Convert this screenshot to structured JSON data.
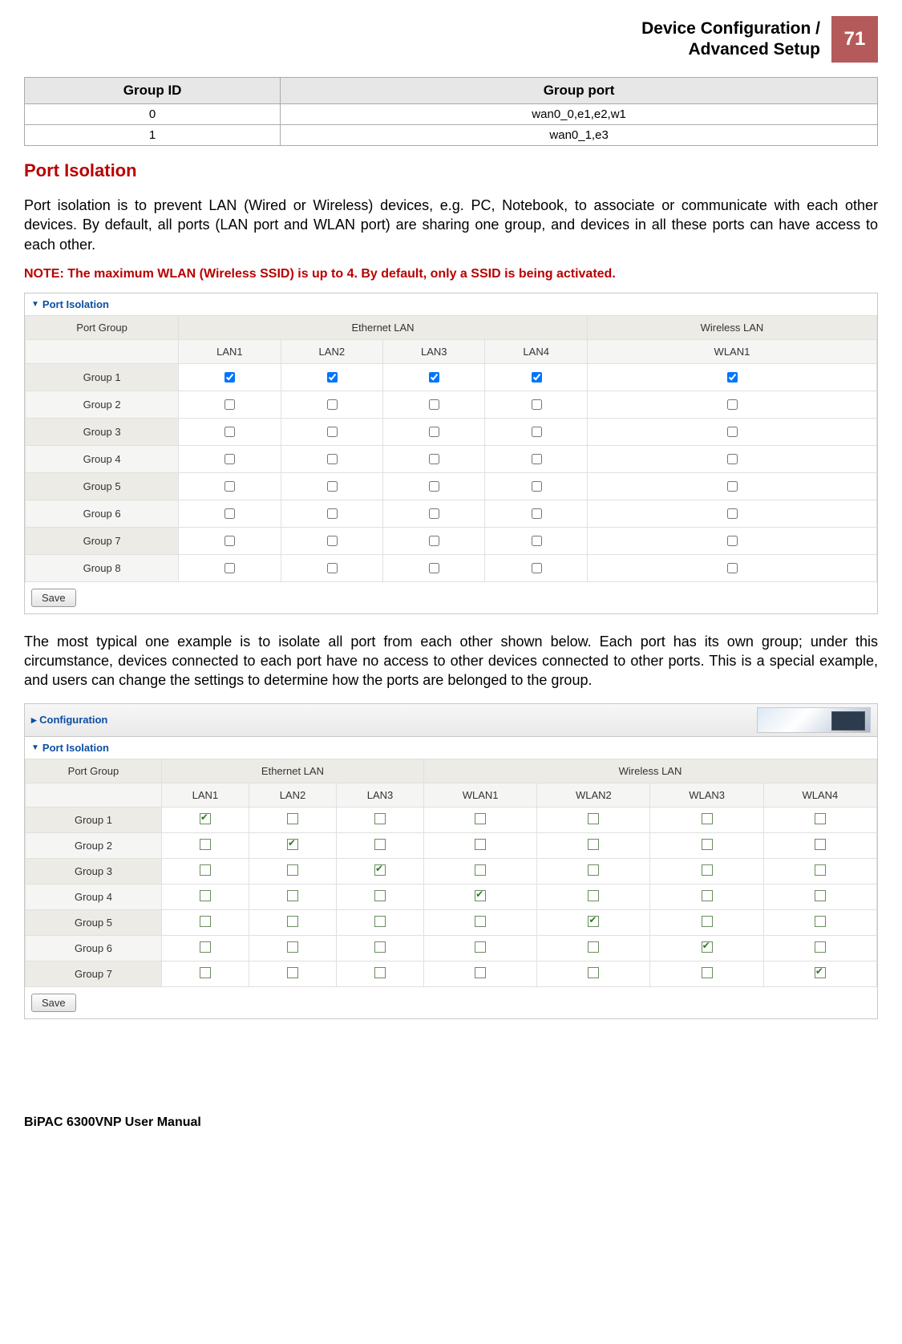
{
  "header": {
    "title_line1": "Device Configuration /",
    "title_line2": "Advanced Setup",
    "page_number": "71"
  },
  "group_table": {
    "headers": [
      "Group ID",
      "Group port"
    ],
    "rows": [
      [
        "0",
        "wan0_0,e1,e2,w1"
      ],
      [
        "1",
        "wan0_1,e3"
      ]
    ]
  },
  "section": {
    "title": "Port Isolation",
    "para1": "Port isolation is to prevent LAN (Wired or Wireless) devices, e.g. PC, Notebook, to associate or communicate with each other devices. By default, all ports (LAN port and WLAN port) are sharing one group, and devices in all these ports can have access to each other.",
    "note": "NOTE: The maximum WLAN (Wireless SSID) is up to 4.  By default, only a SSID is being activated.",
    "para2": "The most typical one example is to isolate all port from each other shown below. Each port has its own group; under this circumstance, devices connected to each port have no access to other devices connected to other ports. This is a special example, and users can change the settings to determine how the ports are belonged to the group."
  },
  "panel1": {
    "title": "Port Isolation",
    "top_headers": [
      "Port Group",
      "Ethernet LAN",
      "Wireless LAN"
    ],
    "sub_headers": [
      "",
      "LAN1",
      "LAN2",
      "LAN3",
      "LAN4",
      "WLAN1"
    ],
    "rows": [
      {
        "label": "Group 1",
        "cells": [
          true,
          true,
          true,
          true,
          true
        ]
      },
      {
        "label": "Group 2",
        "cells": [
          false,
          false,
          false,
          false,
          false
        ]
      },
      {
        "label": "Group 3",
        "cells": [
          false,
          false,
          false,
          false,
          false
        ]
      },
      {
        "label": "Group 4",
        "cells": [
          false,
          false,
          false,
          false,
          false
        ]
      },
      {
        "label": "Group 5",
        "cells": [
          false,
          false,
          false,
          false,
          false
        ]
      },
      {
        "label": "Group 6",
        "cells": [
          false,
          false,
          false,
          false,
          false
        ]
      },
      {
        "label": "Group 7",
        "cells": [
          false,
          false,
          false,
          false,
          false
        ]
      },
      {
        "label": "Group 8",
        "cells": [
          false,
          false,
          false,
          false,
          false
        ]
      }
    ],
    "save_label": "Save"
  },
  "panel2": {
    "config_label": "Configuration",
    "title": "Port Isolation",
    "top_headers": [
      "Port Group",
      "Ethernet LAN",
      "Wireless LAN"
    ],
    "sub_headers": [
      "",
      "LAN1",
      "LAN2",
      "LAN3",
      "WLAN1",
      "WLAN2",
      "WLAN3",
      "WLAN4"
    ],
    "rows": [
      {
        "label": "Group 1",
        "cells": [
          true,
          false,
          false,
          false,
          false,
          false,
          false
        ]
      },
      {
        "label": "Group 2",
        "cells": [
          false,
          true,
          false,
          false,
          false,
          false,
          false
        ]
      },
      {
        "label": "Group 3",
        "cells": [
          false,
          false,
          true,
          false,
          false,
          false,
          false
        ]
      },
      {
        "label": "Group 4",
        "cells": [
          false,
          false,
          false,
          true,
          false,
          false,
          false
        ]
      },
      {
        "label": "Group 5",
        "cells": [
          false,
          false,
          false,
          false,
          true,
          false,
          false
        ]
      },
      {
        "label": "Group 6",
        "cells": [
          false,
          false,
          false,
          false,
          false,
          true,
          false
        ]
      },
      {
        "label": "Group 7",
        "cells": [
          false,
          false,
          false,
          false,
          false,
          false,
          true
        ]
      }
    ],
    "save_label": "Save"
  },
  "footer": {
    "text": "BiPAC 6300VNP User Manual"
  }
}
